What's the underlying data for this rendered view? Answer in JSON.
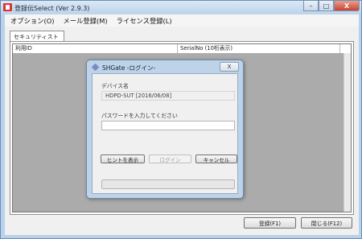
{
  "window": {
    "title": "登録伝Select (Ver 2.9.3)",
    "controls": {
      "minimize": "–",
      "maximize": "□",
      "close": "X"
    }
  },
  "menu": [
    {
      "label": "オプション(O)"
    },
    {
      "label": "メール登録(M)"
    },
    {
      "label": "ライセンス登録(L)"
    }
  ],
  "tab": {
    "label": "セキュリティスト"
  },
  "grid": {
    "columns": [
      "利用ID",
      "SerialNo (10桁表示)"
    ]
  },
  "buttons": {
    "register": "登録(F1)",
    "close": "閉じる(F12)"
  },
  "dialog": {
    "title": "SHGate -ログイン-",
    "close": "X",
    "device_label": "デバイス名",
    "device_value": "HDPD-SUT [2016/06/08]",
    "password_label": "パスワードを入力してください",
    "password_value": "",
    "hint_button": "ヒントを表示",
    "login_button": "ログイン",
    "cancel_button": "キャンセル",
    "progress": 0
  },
  "colors": {
    "frame": "#b9d1ea",
    "grid_empty": "#ababab",
    "close_button": "#c74330"
  }
}
